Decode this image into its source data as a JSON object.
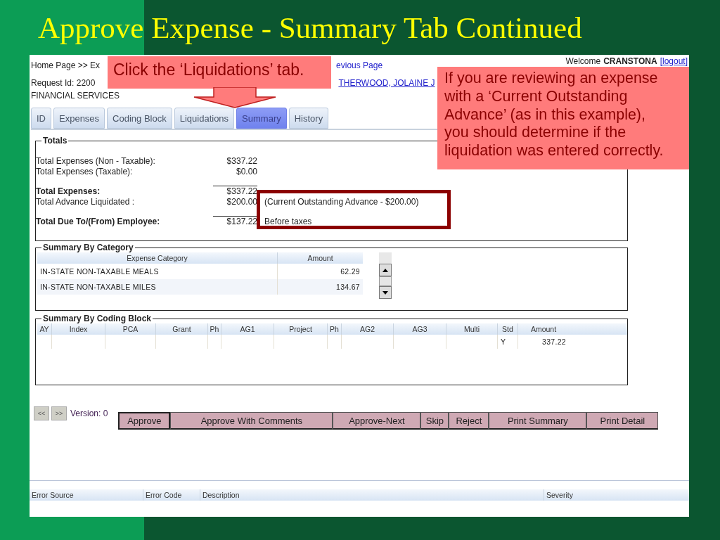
{
  "slide_title": "Approve Expense - Summary Tab Continued",
  "header": {
    "breadcrumb": "Home Page >> Ex",
    "previous_link": "evious Page",
    "welcome": "Welcome",
    "user": "CRANSTONA",
    "logout": "[logout]",
    "request_id": "Request Id: 2200",
    "employee_link": "THERWOOD, JOLAINE J",
    "department": "FINANCIAL SERVICES"
  },
  "tabs": [
    {
      "label": "ID",
      "selected": false
    },
    {
      "label": "Expenses",
      "selected": false
    },
    {
      "label": "Coding Block",
      "selected": false
    },
    {
      "label": "Liquidations",
      "selected": false
    },
    {
      "label": "Summary",
      "selected": true
    },
    {
      "label": "History",
      "selected": false
    }
  ],
  "totals": {
    "title": "Totals",
    "groups": [
      [
        {
          "kind": "line",
          "label": "Total Expenses (Non - Taxable):",
          "amount": "$337.22"
        },
        {
          "kind": "line",
          "label": "Total Expenses (Taxable):",
          "amount": "$0.00"
        }
      ],
      [
        {
          "kind": "subtotal",
          "label": "Total Expenses:",
          "amount": "$337.22"
        },
        {
          "kind": "line",
          "label": "Total Advance Liquidated :",
          "amount": "$200.00",
          "note": "(Current Outstanding Advance - $200.00)"
        }
      ],
      [
        {
          "kind": "subtotal",
          "label": "Total Due To/(From) Employee:",
          "amount": "$137.22",
          "note": "Before taxes"
        }
      ]
    ]
  },
  "summary_by_category": {
    "title": "Summary By Category",
    "columns": [
      "Expense Category",
      "Amount"
    ],
    "rows": [
      {
        "category": "IN-STATE NON-TAXABLE MEALS",
        "amount": "62.29"
      },
      {
        "category": "IN-STATE NON-TAXABLE MILES",
        "amount": "134.67"
      }
    ]
  },
  "summary_by_coding_block": {
    "title": "Summary By Coding Block",
    "columns": [
      "AY",
      "Index",
      "PCA",
      "Grant",
      "Ph",
      "AG1",
      "Project",
      "Ph",
      "AG2",
      "AG3",
      "Multi",
      "Std",
      "Amount"
    ],
    "rows": [
      {
        "std": "Y",
        "amount": "337.22"
      }
    ]
  },
  "navigation": {
    "previous": "<<",
    "next": ">>",
    "version": "Version: 0"
  },
  "actions": [
    {
      "label": "Approve",
      "focused": true
    },
    {
      "label": "Approve With Comments",
      "focused": false
    },
    {
      "label": "Approve-Next",
      "focused": false
    },
    {
      "label": "Skip",
      "focused": false
    },
    {
      "label": "Reject",
      "focused": false
    },
    {
      "label": "Print Summary",
      "focused": false
    },
    {
      "label": "Print Detail",
      "focused": false
    }
  ],
  "errors": {
    "columns": [
      "Error Source",
      "Error Code",
      "Description",
      "Severity"
    ]
  },
  "callouts": [
    {
      "kind": "arrow",
      "text": "Click the ‘Liquidations’ tab."
    },
    {
      "kind": "note",
      "text": "If you are reviewing an expense with a ‘Current Outstanding Advance’ (as in this example), you should determine if the liquidation was entered correctly."
    }
  ]
}
